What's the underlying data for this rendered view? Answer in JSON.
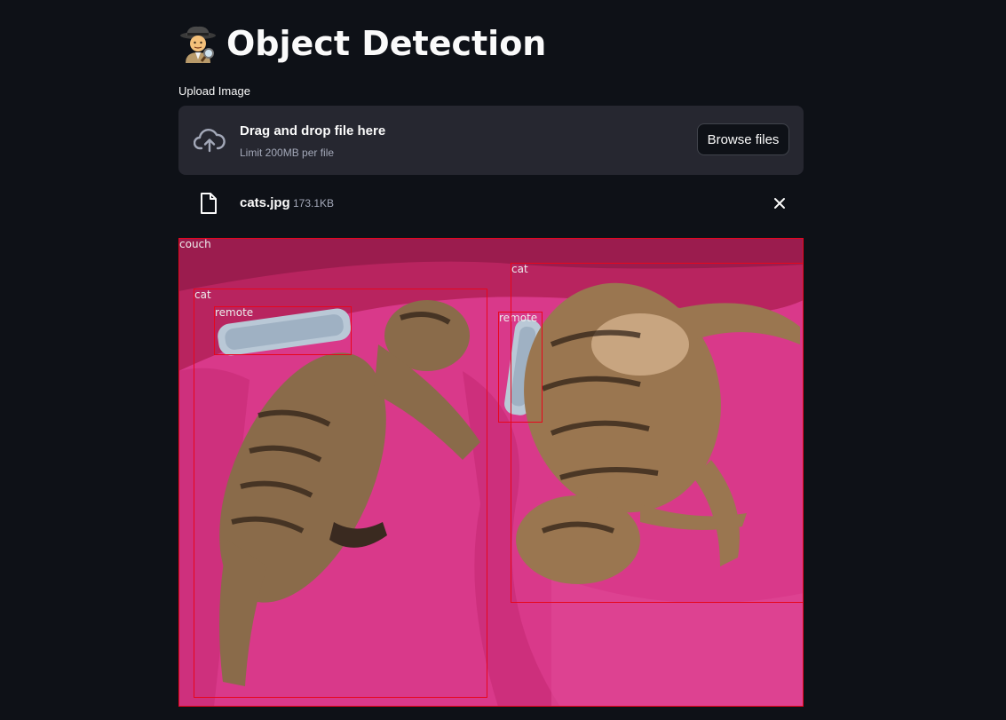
{
  "header": {
    "title": "Object Detection",
    "title_icon": "detective-emoji"
  },
  "uploader": {
    "label": "Upload Image",
    "drag_text": "Drag and drop file here",
    "limit_text": "Limit 200MB per file",
    "browse_label": "Browse files",
    "icon": "cloud-upload-icon"
  },
  "file": {
    "name": "cats.jpg",
    "size": "173.1KB",
    "icon": "file-icon",
    "remove_icon": "close-icon"
  },
  "detections": [
    {
      "label": "couch"
    },
    {
      "label": "cat"
    },
    {
      "label": "remote"
    },
    {
      "label": "remote"
    },
    {
      "label": "cat"
    }
  ],
  "colors": {
    "background": "#0e1117",
    "dropzone": "#262730",
    "box": "#e8061c",
    "couch": "#d63884"
  }
}
